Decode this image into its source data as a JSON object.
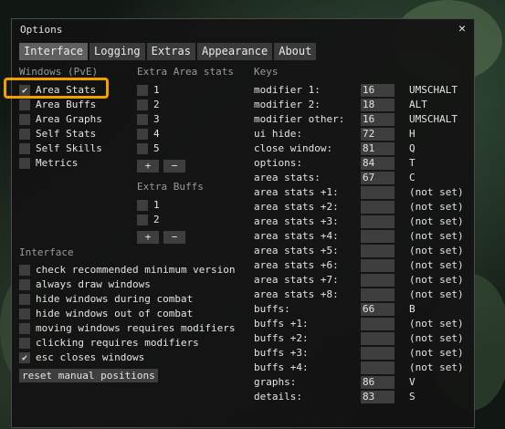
{
  "window": {
    "title": "Options",
    "close_glyph": "✕"
  },
  "tabs": [
    "Interface",
    "Logging",
    "Extras",
    "Appearance",
    "About"
  ],
  "windows_section": {
    "header": "Windows (PvE)",
    "items": [
      {
        "label": "Area Stats",
        "checked": true
      },
      {
        "label": "Area Buffs",
        "checked": false
      },
      {
        "label": "Area Graphs",
        "checked": false
      },
      {
        "label": "Self Stats",
        "checked": false
      },
      {
        "label": "Self Skills",
        "checked": false
      },
      {
        "label": "Metrics",
        "checked": false
      }
    ]
  },
  "extra_area_stats": {
    "header": "Extra Area stats",
    "items": [
      "1",
      "2",
      "3",
      "4",
      "5"
    ],
    "plus": "+",
    "minus": "−"
  },
  "extra_buffs": {
    "header": "Extra Buffs",
    "items": [
      "1",
      "2"
    ],
    "plus": "+",
    "minus": "−"
  },
  "interface_section": {
    "header": "Interface",
    "items": [
      {
        "label": "check recommended minimum version",
        "checked": false
      },
      {
        "label": "always draw windows",
        "checked": false
      },
      {
        "label": "hide windows during combat",
        "checked": false
      },
      {
        "label": "hide windows out of combat",
        "checked": false
      },
      {
        "label": "moving windows requires modifiers",
        "checked": false
      },
      {
        "label": "clicking requires modifiers",
        "checked": false
      },
      {
        "label": "esc closes windows",
        "checked": true
      }
    ],
    "reset_label": "reset manual positions"
  },
  "keys": {
    "header": "Keys",
    "items": [
      {
        "name": "modifier 1:",
        "code": "16",
        "value": "UMSCHALT"
      },
      {
        "name": "modifier 2:",
        "code": "18",
        "value": "ALT"
      },
      {
        "name": "modifier other:",
        "code": "16",
        "value": "UMSCHALT"
      },
      {
        "name": "ui hide:",
        "code": "72",
        "value": "H"
      },
      {
        "name": "close window:",
        "code": "81",
        "value": "Q"
      },
      {
        "name": "options:",
        "code": "84",
        "value": "T"
      },
      {
        "name": "area stats:",
        "code": "67",
        "value": "C"
      },
      {
        "name": "area stats +1:",
        "code": "",
        "value": "(not set)"
      },
      {
        "name": "area stats +2:",
        "code": "",
        "value": "(not set)"
      },
      {
        "name": "area stats +3:",
        "code": "",
        "value": "(not set)"
      },
      {
        "name": "area stats +4:",
        "code": "",
        "value": "(not set)"
      },
      {
        "name": "area stats +5:",
        "code": "",
        "value": "(not set)"
      },
      {
        "name": "area stats +6:",
        "code": "",
        "value": "(not set)"
      },
      {
        "name": "area stats +7:",
        "code": "",
        "value": "(not set)"
      },
      {
        "name": "area stats +8:",
        "code": "",
        "value": "(not set)"
      },
      {
        "name": "buffs:",
        "code": "66",
        "value": "B"
      },
      {
        "name": "buffs +1:",
        "code": "",
        "value": "(not set)"
      },
      {
        "name": "buffs +2:",
        "code": "",
        "value": "(not set)"
      },
      {
        "name": "buffs +3:",
        "code": "",
        "value": "(not set)"
      },
      {
        "name": "buffs +4:",
        "code": "",
        "value": "(not set)"
      },
      {
        "name": "graphs:",
        "code": "86",
        "value": "V"
      },
      {
        "name": "details:",
        "code": "83",
        "value": "S"
      }
    ]
  },
  "colors": {
    "highlight": "#f0a000",
    "window_bg": "#121212",
    "control_bg": "#3e3e3e",
    "active_tab": "#5f5f5f"
  }
}
